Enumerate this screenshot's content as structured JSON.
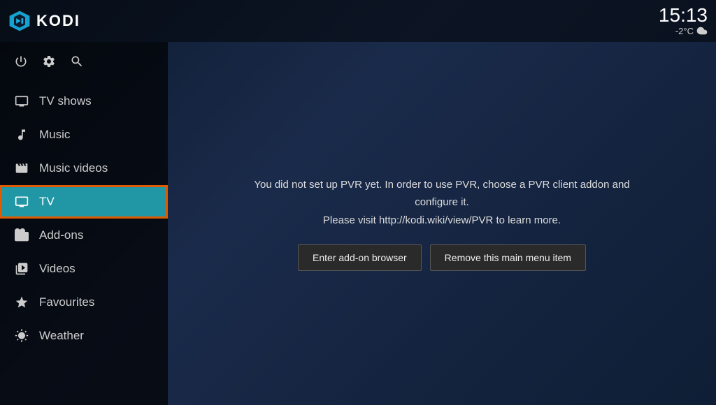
{
  "app": {
    "logo_text": "KODI"
  },
  "topbar": {
    "clock": "15:13",
    "temperature": "-2°C",
    "weather_icon": "cloud"
  },
  "sidebar": {
    "items": [
      {
        "id": "tv-shows",
        "label": "TV shows",
        "icon": "tv"
      },
      {
        "id": "music",
        "label": "Music",
        "icon": "music"
      },
      {
        "id": "music-videos",
        "label": "Music videos",
        "icon": "film"
      },
      {
        "id": "tv",
        "label": "TV",
        "icon": "monitor",
        "active": true
      },
      {
        "id": "add-ons",
        "label": "Add-ons",
        "icon": "box"
      },
      {
        "id": "videos",
        "label": "Videos",
        "icon": "grid"
      },
      {
        "id": "favourites",
        "label": "Favourites",
        "icon": "star"
      },
      {
        "id": "weather",
        "label": "Weather",
        "icon": "weather"
      }
    ]
  },
  "pvr": {
    "message_line1": "You did not set up PVR yet. In order to use PVR, choose a PVR client addon and configure it.",
    "message_line2": "Please visit http://kodi.wiki/view/PVR to learn more.",
    "btn_addon_browser": "Enter add-on browser",
    "btn_remove_item": "Remove this main menu item"
  },
  "controls": {
    "power": "⏻",
    "settings": "⚙",
    "search": "🔍"
  }
}
